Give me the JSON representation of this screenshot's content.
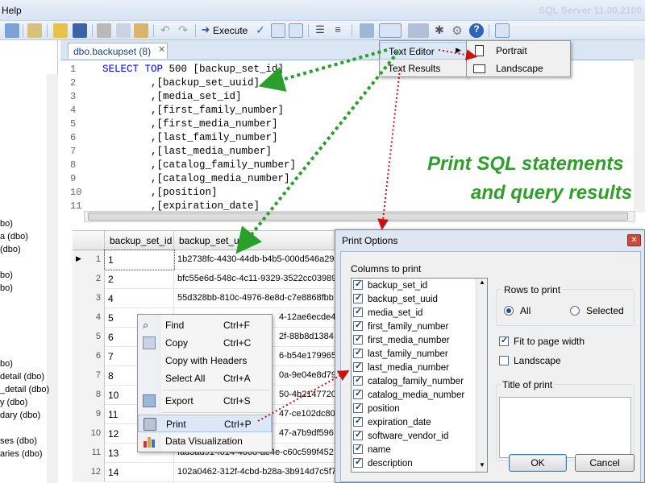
{
  "menubar": {
    "help": "Help"
  },
  "app_title": "SQL Server 11.00.2100",
  "toolbar": {
    "execute_label": "Execute"
  },
  "left_tree": [
    {
      "label": "bo)"
    },
    {
      "label": "a (dbo)"
    },
    {
      "label": "(dbo)"
    },
    {
      "label": "bo)"
    },
    {
      "label": "bo)"
    },
    {
      "label": "bo)"
    },
    {
      "label": "detail (dbo)"
    },
    {
      "label": "_detail (dbo)"
    },
    {
      "label": "y (dbo)"
    },
    {
      "label": "dary (dbo)"
    },
    {
      "label": "ses (dbo)"
    },
    {
      "label": "aries (dbo)"
    }
  ],
  "editor": {
    "tab_label": "dbo.backupset (8)",
    "lines": [
      {
        "n": "1",
        "kw": "SELECT TOP",
        "text": " 500 [backup_set_id]"
      },
      {
        "n": "2",
        "kw": "",
        "text": "        ,[backup_set_uuid]"
      },
      {
        "n": "3",
        "kw": "",
        "text": "        ,[media_set_id]"
      },
      {
        "n": "4",
        "kw": "",
        "text": "        ,[first_family_number]"
      },
      {
        "n": "5",
        "kw": "",
        "text": "        ,[first_media_number]"
      },
      {
        "n": "6",
        "kw": "",
        "text": "        ,[last_family_number]"
      },
      {
        "n": "7",
        "kw": "",
        "text": "        ,[last_media_number]"
      },
      {
        "n": "8",
        "kw": "",
        "text": "        ,[catalog_family_number]"
      },
      {
        "n": "9",
        "kw": "",
        "text": "        ,[catalog_media_number]"
      },
      {
        "n": "10",
        "kw": "",
        "text": "        ,[position]"
      },
      {
        "n": "11",
        "kw": "",
        "text": "        ,[expiration_date]"
      }
    ]
  },
  "grid": {
    "headers": [
      "backup_set_id",
      "backup_set_uuid"
    ],
    "rows": [
      {
        "ind": "1",
        "id": "1",
        "uuid": "1b2738fc-4430-44db-b4b5-000d546a29"
      },
      {
        "ind": "2",
        "id": "2",
        "uuid": "bfc55e6d-548c-4c11-9329-3522cc03989"
      },
      {
        "ind": "3",
        "id": "4",
        "uuid": "55d328bb-810c-4976-8e8d-c7e8868fbb"
      },
      {
        "ind": "4",
        "id": "5",
        "uuid": "4-12ae6ecde4f"
      },
      {
        "ind": "5",
        "id": "6",
        "uuid": "2f-88b8d1384"
      },
      {
        "ind": "6",
        "id": "7",
        "uuid": "6-b54e179965"
      },
      {
        "ind": "7",
        "id": "8",
        "uuid": "0a-9e04e8d792"
      },
      {
        "ind": "8",
        "id": "10",
        "uuid": "50-4b2147720e"
      },
      {
        "ind": "9",
        "id": "11",
        "uuid": "47-ce102dc80f7"
      },
      {
        "ind": "10",
        "id": "12",
        "uuid": "47-a7b9df596"
      },
      {
        "ind": "11",
        "id": "13",
        "uuid": "fad3ad91-f614-4008-ae4e-c60c599f452"
      },
      {
        "ind": "12",
        "id": "14",
        "uuid": "102a0462-312f-4cbd-b28a-3b914d7c5f7"
      }
    ]
  },
  "print_menu": {
    "items": [
      "Text Editor",
      "Text Results"
    ],
    "submenu": [
      "Portrait",
      "Landscape"
    ]
  },
  "context_menu": {
    "items": [
      {
        "label": "Find",
        "shortcut": "Ctrl+F",
        "icon": "binoculars-icon"
      },
      {
        "label": "Copy",
        "shortcut": "Ctrl+C",
        "icon": "copy-icon"
      },
      {
        "label": "Copy with Headers",
        "shortcut": "",
        "icon": ""
      },
      {
        "label": "Select All",
        "shortcut": "Ctrl+A",
        "icon": ""
      },
      {
        "label": "Export",
        "shortcut": "Ctrl+S",
        "icon": "export-icon"
      },
      {
        "label": "Print",
        "shortcut": "Ctrl+P",
        "icon": "printer-icon"
      },
      {
        "label": "Data Visualization",
        "shortcut": "",
        "icon": "bar-chart-icon"
      }
    ]
  },
  "dialog": {
    "title": "Print Options",
    "columns_caption": "Columns to print",
    "columns": [
      "backup_set_id",
      "backup_set_uuid",
      "media_set_id",
      "first_family_number",
      "first_media_number",
      "last_family_number",
      "last_media_number",
      "catalog_family_number",
      "catalog_media_number",
      "position",
      "expiration_date",
      "software_vendor_id",
      "name",
      "description"
    ],
    "rows_caption": "Rows to print",
    "rows_all": "All",
    "rows_selected": "Selected",
    "fit_to_page": "Fit to page width",
    "landscape": "Landscape",
    "title_caption": "Title of print",
    "ok": "OK",
    "cancel": "Cancel"
  },
  "promo": {
    "line1": "Print SQL statements",
    "line2": "and query results"
  },
  "colors": {
    "accent_green": "#2f9e2a",
    "arrow_red": "#cc1111"
  }
}
